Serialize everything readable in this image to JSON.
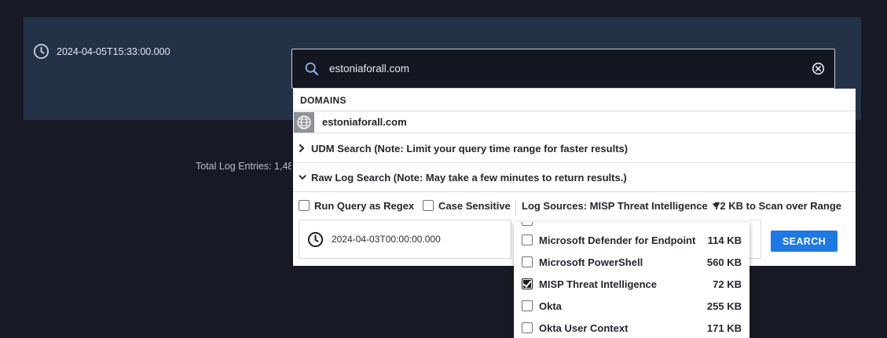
{
  "header": {
    "timestamp": "2024-04-05T15:33:00.000",
    "total_entries_text": "Total Log Entries: 1,48"
  },
  "search": {
    "value": "estoniaforall.com",
    "placeholder": ""
  },
  "dropdown": {
    "domains_header": "DOMAINS",
    "domain_result": "estoniaforall.com",
    "udm_search_label": "UDM Search (Note: Limit your query time range for faster results)",
    "raw_log_label": "Raw Log Search (Note: May take a few minutes to return results.)",
    "options": {
      "regex_label": "Run Query as Regex",
      "case_label": "Case Sensitive",
      "log_sources_label": "Log Sources: MISP Threat Intelligence",
      "scan_info": "72 KB to Scan over Range"
    },
    "start_time": "2024-04-03T00:00:00.000",
    "search_button": "SEARCH"
  },
  "log_sources": [
    {
      "name": "Microsoft Defender for Endpoint",
      "size": "114 KB",
      "checked": false
    },
    {
      "name": "Microsoft PowerShell",
      "size": "560 KB",
      "checked": false
    },
    {
      "name": "MISP Threat Intelligence",
      "size": "72 KB",
      "checked": true
    },
    {
      "name": "Okta",
      "size": "255 KB",
      "checked": false
    },
    {
      "name": "Okta User Context",
      "size": "171 KB",
      "checked": false
    }
  ],
  "colors": {
    "accent": "#1e79e4",
    "panel": "#243248",
    "background": "#171a24"
  },
  "icons": [
    "clock-icon",
    "search-icon",
    "clear-icon",
    "globe-icon",
    "chevron-right-icon",
    "chevron-down-icon",
    "caret-down-icon",
    "checkbox-icon"
  ]
}
